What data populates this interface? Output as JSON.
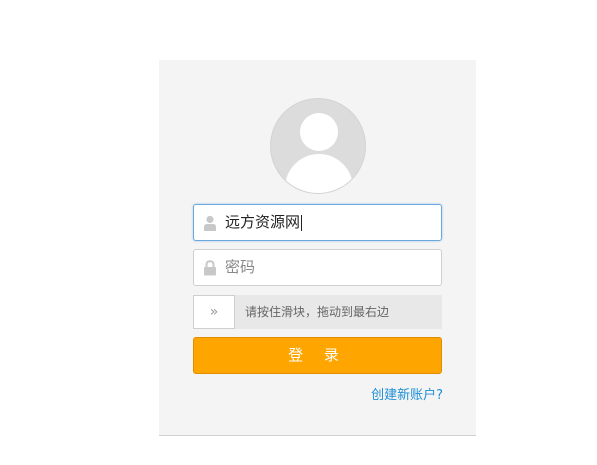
{
  "login": {
    "username_value": "远方资源网",
    "password_placeholder": "密码",
    "slider_hint": "请按住滑块，拖动到最右边",
    "slider_handle_glyph": "»",
    "login_button": "登 录",
    "register_link": "创建新账户?"
  },
  "icons": {
    "avatar": "default-user-avatar",
    "user": "user-icon",
    "lock": "lock-icon",
    "slider": "double-chevron-right-icon"
  },
  "colors": {
    "panel_bg": "#f4f4f4",
    "login_button": "#ffa500",
    "link": "#1e8fd6",
    "focus_border": "#6aa8dd"
  }
}
